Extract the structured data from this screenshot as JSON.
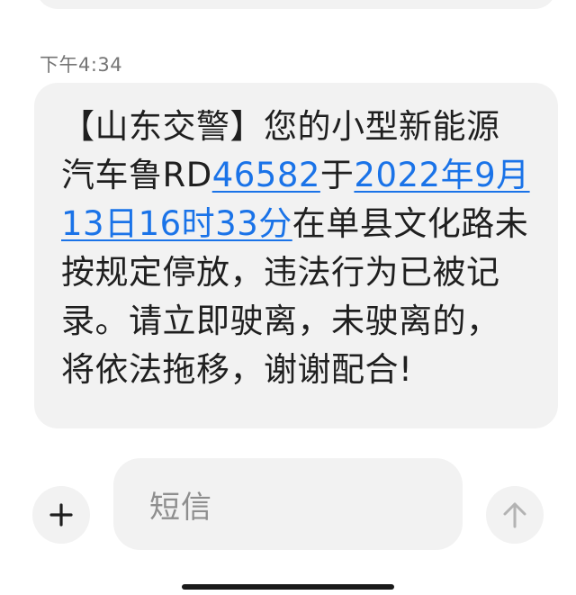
{
  "thread": {
    "timestamp": "下午4:34"
  },
  "message": {
    "sender_tag": "【山东交警】",
    "text_1": "您的小型新能源汽车鲁RD",
    "plate_link": "46582",
    "text_2": "于",
    "datetime_link": "2022年9月13日16时33分",
    "text_3": "在单县文化路未按规定停放，违法行为已被记录。请立即驶离，未驶离的，将依法拖移，谢谢配合!"
  },
  "composer": {
    "placeholder": "短信",
    "add_icon": "plus-icon",
    "send_icon": "arrow-up-icon"
  },
  "colors": {
    "bubble": "#f2f2f2",
    "link": "#1a73e8",
    "text": "#1f1f1f",
    "muted": "#757575"
  }
}
